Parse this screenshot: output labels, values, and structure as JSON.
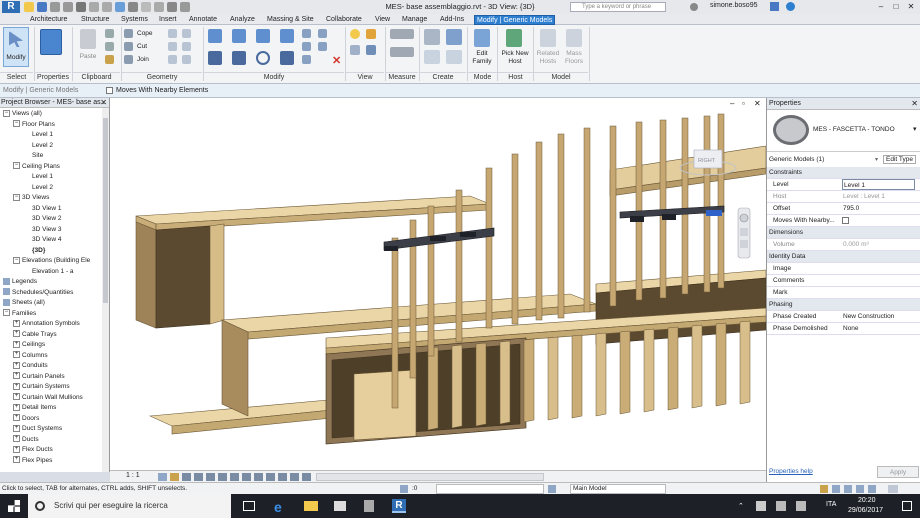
{
  "window": {
    "title": "MES- base assemblaggio.rvt - 3D View: {3D}",
    "search_placeholder": "Type a keyword or phrase",
    "user": "simone.boso95",
    "app_logo": "R"
  },
  "tabs": [
    "Architecture",
    "Structure",
    "Systems",
    "Insert",
    "Annotate",
    "Analyze",
    "Massing & Site",
    "Collaborate",
    "View",
    "Manage",
    "Add-Ins",
    "Modify | Generic Models"
  ],
  "ribbon": {
    "panels": {
      "select": "Select",
      "properties": "Properties",
      "clipboard": "Clipboard",
      "geometry": "Geometry",
      "modify": "Modify",
      "view": "View",
      "measure": "Measure",
      "create": "Create",
      "mode": "Mode",
      "host": "Host",
      "model": "Model"
    },
    "buttons": {
      "modify": "Modify",
      "paste": "Paste",
      "cope": "Cope",
      "cut": "Cut",
      "join": "Join",
      "edit_family": "Edit Family",
      "pick_new_host": "Pick New Host",
      "related_hosts": "Related Hosts",
      "mass_floors": "Mass Floors"
    }
  },
  "options_bar": {
    "context": "Modify | Generic Models",
    "checkbox_label": "Moves With Nearby Elements"
  },
  "project_browser": {
    "title": "Project Browser - MES- base as...",
    "items": [
      {
        "label": "Views (all)",
        "level": 0,
        "exp": "-"
      },
      {
        "label": "Floor Plans",
        "level": 1,
        "exp": "-"
      },
      {
        "label": "Level 1",
        "level": 2,
        "exp": ""
      },
      {
        "label": "Level 2",
        "level": 2,
        "exp": ""
      },
      {
        "label": "Site",
        "level": 2,
        "exp": ""
      },
      {
        "label": "Ceiling Plans",
        "level": 1,
        "exp": "-"
      },
      {
        "label": "Level 1",
        "level": 2,
        "exp": ""
      },
      {
        "label": "Level 2",
        "level": 2,
        "exp": ""
      },
      {
        "label": "3D Views",
        "level": 1,
        "exp": "-"
      },
      {
        "label": "3D View 1",
        "level": 2,
        "exp": ""
      },
      {
        "label": "3D View 2",
        "level": 2,
        "exp": ""
      },
      {
        "label": "3D View 3",
        "level": 2,
        "exp": ""
      },
      {
        "label": "3D View 4",
        "level": 2,
        "exp": ""
      },
      {
        "label": "{3D}",
        "level": 2,
        "exp": "",
        "bold": true
      },
      {
        "label": "Elevations (Building Ele",
        "level": 1,
        "exp": "-"
      },
      {
        "label": "Elevation 1 - a",
        "level": 2,
        "exp": ""
      },
      {
        "label": "Legends",
        "level": 0,
        "exp": ""
      },
      {
        "label": "Schedules/Quantities",
        "level": 0,
        "exp": ""
      },
      {
        "label": "Sheets (all)",
        "level": 0,
        "exp": ""
      },
      {
        "label": "Families",
        "level": 0,
        "exp": "-"
      },
      {
        "label": "Annotation Symbols",
        "level": 1,
        "exp": "+"
      },
      {
        "label": "Cable Trays",
        "level": 1,
        "exp": "+"
      },
      {
        "label": "Ceilings",
        "level": 1,
        "exp": "+"
      },
      {
        "label": "Columns",
        "level": 1,
        "exp": "+"
      },
      {
        "label": "Conduits",
        "level": 1,
        "exp": "+"
      },
      {
        "label": "Curtain Panels",
        "level": 1,
        "exp": "+"
      },
      {
        "label": "Curtain Systems",
        "level": 1,
        "exp": "+"
      },
      {
        "label": "Curtain Wall Mullions",
        "level": 1,
        "exp": "+"
      },
      {
        "label": "Detail Items",
        "level": 1,
        "exp": "+"
      },
      {
        "label": "Doors",
        "level": 1,
        "exp": "+"
      },
      {
        "label": "Duct Systems",
        "level": 1,
        "exp": "+"
      },
      {
        "label": "Ducts",
        "level": 1,
        "exp": "+"
      },
      {
        "label": "Flex Ducts",
        "level": 1,
        "exp": "+"
      },
      {
        "label": "Flex Pipes",
        "level": 1,
        "exp": "+"
      }
    ]
  },
  "view": {
    "scale": "1 : 1",
    "viewcube_label": "RIGHT"
  },
  "properties": {
    "title": "Properties",
    "type_name": "MES - FASCETTA - TONDO",
    "selector": "Generic Models (1)",
    "edit_type": "Edit Type",
    "rows": [
      {
        "group": true,
        "key": "Constraints",
        "value": ""
      },
      {
        "group": false,
        "key": "Level",
        "value": "Level 1",
        "boxed": true
      },
      {
        "group": false,
        "key": "Host",
        "value": "Level : Level 1",
        "grey": true
      },
      {
        "group": false,
        "key": "Offset",
        "value": "795.0"
      },
      {
        "group": false,
        "key": "Moves With Nearby...",
        "value": "",
        "checkbox": true
      },
      {
        "group": true,
        "key": "Dimensions",
        "value": ""
      },
      {
        "group": false,
        "key": "Volume",
        "value": "0.000 m³",
        "grey": true
      },
      {
        "group": true,
        "key": "Identity Data",
        "value": ""
      },
      {
        "group": false,
        "key": "Image",
        "value": ""
      },
      {
        "group": false,
        "key": "Comments",
        "value": ""
      },
      {
        "group": false,
        "key": "Mark",
        "value": ""
      },
      {
        "group": true,
        "key": "Phasing",
        "value": ""
      },
      {
        "group": false,
        "key": "Phase Created",
        "value": "New Construction"
      },
      {
        "group": false,
        "key": "Phase Demolished",
        "value": "None"
      }
    ],
    "help_link": "Properties help",
    "apply": "Apply"
  },
  "status": {
    "hint": "Click to select, TAB for alternates, CTRL adds, SHIFT unselects.",
    "zero": ":0",
    "model": "Main Model"
  },
  "taskbar": {
    "search_placeholder": "Scrivi qui per eseguire la ricerca",
    "lang": "ITA",
    "time": "20:20",
    "date": "29/06/2017"
  },
  "colors": {
    "wood": "#dcc38f",
    "wood_dark": "#8f7654",
    "accent": "#2f7fd0"
  }
}
